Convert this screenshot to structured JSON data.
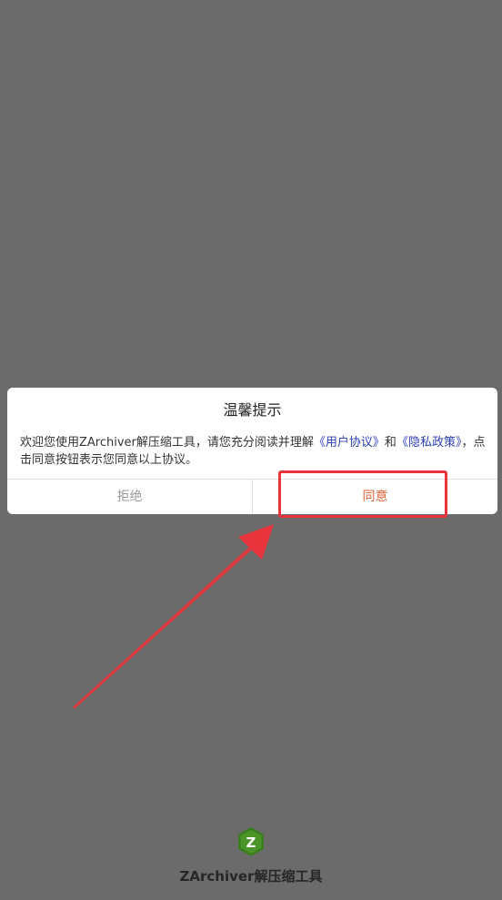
{
  "dialog": {
    "title": "温馨提示",
    "message_prefix": "欢迎您使用ZArchiver解压缩工具，请您充分阅读并理解",
    "user_agreement_link": "《用户协议》",
    "conjunction": "和",
    "privacy_policy_link": "《隐私政策》",
    "message_suffix": "，点击同意按钮表示您同意以上协议。",
    "reject_label": "拒绝",
    "agree_label": "同意"
  },
  "app": {
    "name": "ZArchiver解压缩工具",
    "logo_letter": "Z"
  },
  "colors": {
    "background": "#6b6b6b",
    "link": "#2b3fb3",
    "agree": "#e0643a",
    "reject": "#9a9a9a",
    "annotation": "#e8343a",
    "logo": "#3a7d1f"
  }
}
